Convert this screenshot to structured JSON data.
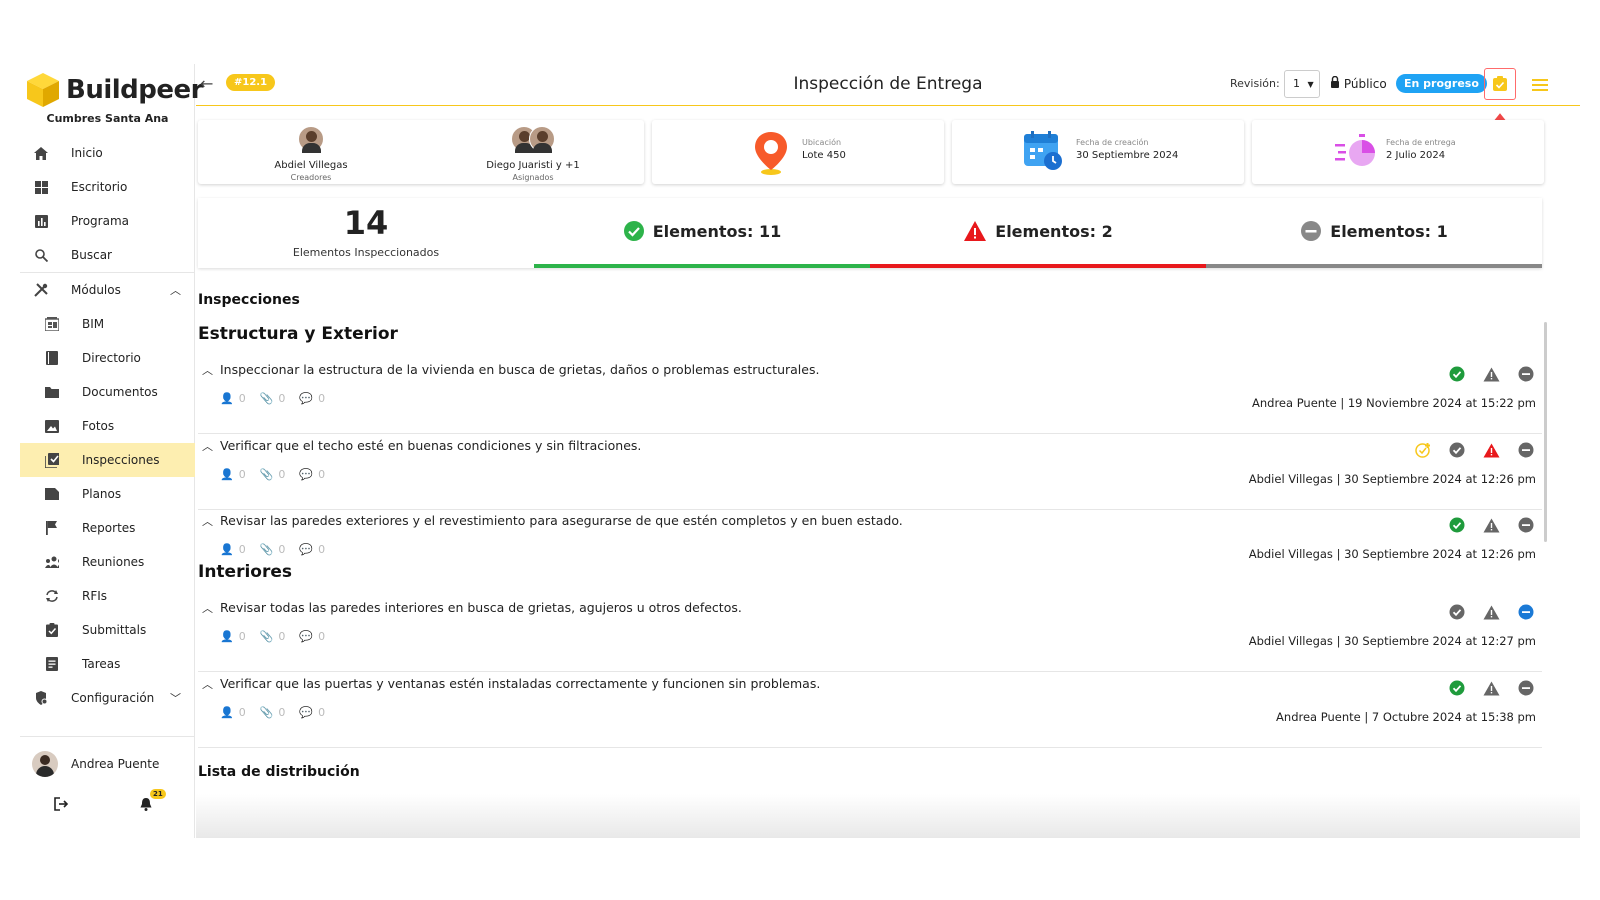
{
  "brand": {
    "name": "Buildpeer",
    "project": "Cumbres Santa Ana",
    "accent": "#f7c71b"
  },
  "sidebar": {
    "items": [
      {
        "label": "Inicio",
        "icon": "home-icon"
      },
      {
        "label": "Escritorio",
        "icon": "dashboard-icon"
      },
      {
        "label": "Programa",
        "icon": "chart-icon"
      },
      {
        "label": "Buscar",
        "icon": "search-icon"
      },
      {
        "label": "Módulos",
        "icon": "tools-icon"
      },
      {
        "label": "BIM",
        "icon": "bim-icon"
      },
      {
        "label": "Directorio",
        "icon": "book-icon"
      },
      {
        "label": "Documentos",
        "icon": "folder-icon"
      },
      {
        "label": "Fotos",
        "icon": "image-icon"
      },
      {
        "label": "Inspecciones",
        "icon": "checklist-icon"
      },
      {
        "label": "Planos",
        "icon": "plans-icon"
      },
      {
        "label": "Reportes",
        "icon": "flag-icon"
      },
      {
        "label": "Reuniones",
        "icon": "people-icon"
      },
      {
        "label": "RFIs",
        "icon": "sync-icon"
      },
      {
        "label": "Submittals",
        "icon": "clipboard-check-icon"
      },
      {
        "label": "Tareas",
        "icon": "tasks-icon"
      },
      {
        "label": "Configuración",
        "icon": "settings-icon"
      }
    ],
    "user": "Andrea Puente",
    "notifications": "21"
  },
  "header": {
    "badge": "#12.1",
    "title": "Inspección de Entrega",
    "revision_label": "Revisión:",
    "revision_value": "1",
    "visibility": "Público",
    "status": "En progreso"
  },
  "cards": {
    "creator": {
      "name": "Abdiel Villegas",
      "role": "Creadores"
    },
    "assignee": {
      "name": "Diego Juaristi y +1",
      "role": "Asignados"
    },
    "location": {
      "label": "Ubicación",
      "value": "Lote 450"
    },
    "created": {
      "label": "Fecha de creación",
      "value": "30 Septiembre 2024"
    },
    "delivery": {
      "label": "Fecha de entrega",
      "value": "2 Julio 2024"
    }
  },
  "summary": {
    "count": "14",
    "count_label": "Elementos Inspeccionados",
    "ok": "Elementos: 11",
    "fail": "Elementos: 2",
    "na": "Elementos: 1",
    "colors": {
      "ok": "#2db34a",
      "fail": "#e8181c",
      "na": "#888888"
    }
  },
  "sections": {
    "inspections_title": "Inspecciones",
    "group1": "Estructura y Exterior",
    "group2": "Interiores",
    "distribution_title": "Lista de distribución"
  },
  "items": [
    {
      "text": "Inspeccionar la estructura de la vivienda en busca de grietas, daños o problemas estructurales.",
      "people": "0",
      "files": "0",
      "comments": "0",
      "who": "Andrea Puente | 19 Noviembre 2024 at 15:22 pm",
      "status": "ok"
    },
    {
      "text": "Verificar que el techo esté en buenas condiciones y sin filtraciones.",
      "people": "0",
      "files": "0",
      "comments": "0",
      "who": "Abdiel Villegas | 30 Septiembre 2024 at 12:26 pm",
      "status": "fail"
    },
    {
      "text": "Revisar las paredes exteriores y el revestimiento para asegurarse de que estén completos y en buen estado.",
      "people": "0",
      "files": "0",
      "comments": "0",
      "who": "Abdiel Villegas | 30 Septiembre 2024 at 12:26 pm",
      "status": "ok"
    },
    {
      "text": "Revisar todas las paredes interiores en busca de grietas, agujeros u otros defectos.",
      "people": "0",
      "files": "0",
      "comments": "0",
      "who": "Abdiel Villegas | 30 Septiembre 2024 at 12:27 pm",
      "status": "na"
    },
    {
      "text": "Verificar que las puertas y ventanas estén instaladas correctamente y funcionen sin problemas.",
      "people": "0",
      "files": "0",
      "comments": "0",
      "who": "Andrea Puente | 7 Octubre 2024 at 15:38 pm",
      "status": "ok"
    }
  ]
}
